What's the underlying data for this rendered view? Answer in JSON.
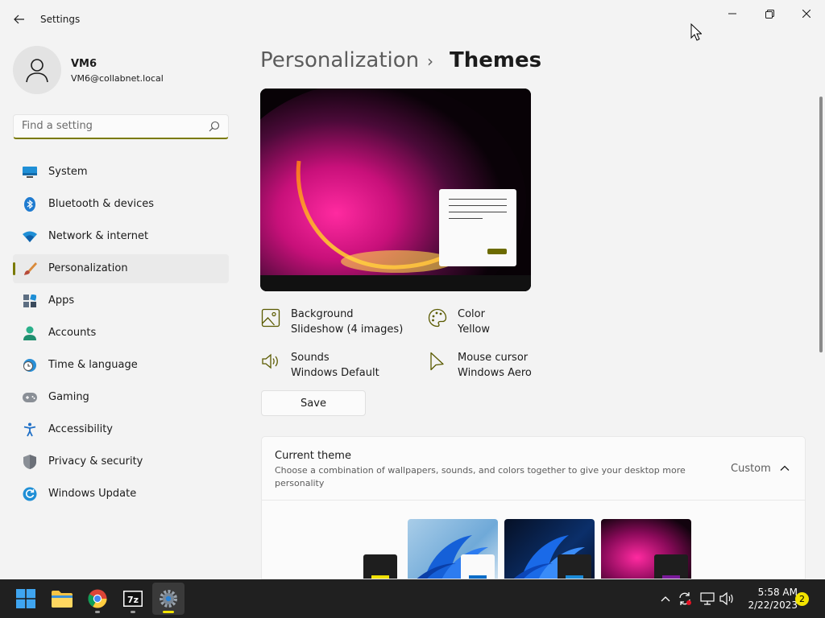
{
  "window": {
    "title": "Settings",
    "minimize_icon": "minimize-icon",
    "maximize_icon": "restore-icon",
    "close_icon": "close-icon"
  },
  "user": {
    "name": "VM6",
    "email": "VM6@collabnet.local"
  },
  "search": {
    "placeholder": "Find a setting"
  },
  "sidebar": {
    "items": [
      {
        "label": "System",
        "icon": "monitor-icon"
      },
      {
        "label": "Bluetooth & devices",
        "icon": "bluetooth-icon"
      },
      {
        "label": "Network & internet",
        "icon": "wifi-icon"
      },
      {
        "label": "Personalization",
        "icon": "brush-icon",
        "active": true
      },
      {
        "label": "Apps",
        "icon": "apps-icon"
      },
      {
        "label": "Accounts",
        "icon": "person-icon"
      },
      {
        "label": "Time & language",
        "icon": "clock-globe-icon"
      },
      {
        "label": "Gaming",
        "icon": "gamepad-icon"
      },
      {
        "label": "Accessibility",
        "icon": "accessibility-icon"
      },
      {
        "label": "Privacy & security",
        "icon": "shield-icon"
      },
      {
        "label": "Windows Update",
        "icon": "update-icon"
      }
    ]
  },
  "breadcrumb": {
    "parent": "Personalization",
    "separator": "›",
    "current": "Themes"
  },
  "theme_props": {
    "background": {
      "title": "Background",
      "value": "Slideshow (4 images)"
    },
    "color": {
      "title": "Color",
      "value": "Yellow"
    },
    "sounds": {
      "title": "Sounds",
      "value": "Windows Default"
    },
    "cursor": {
      "title": "Mouse cursor",
      "value": "Windows Aero"
    }
  },
  "save_label": "Save",
  "current_theme": {
    "title": "Current theme",
    "description": "Choose a combination of wallpapers, sounds, and colors together to give your desktop more personality",
    "value": "Custom"
  },
  "taskbar": {
    "apps": [
      "start-icon",
      "file-explorer-icon",
      "chrome-icon",
      "7zip-icon",
      "settings-icon"
    ],
    "seven_zip_label": "7z",
    "time": "5:58 AM",
    "date": "2/22/2023",
    "notifications": "2"
  },
  "colors": {
    "accent": "#7a7a00",
    "accent_bright": "#f2e300",
    "taskbar": "#202020"
  }
}
